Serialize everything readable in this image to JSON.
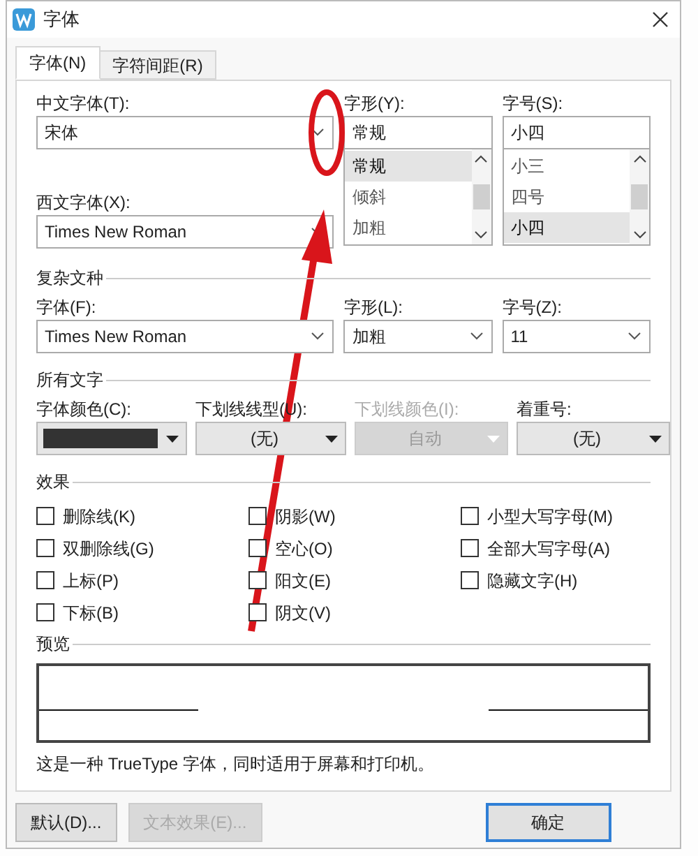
{
  "window": {
    "title": "字体"
  },
  "tabs": [
    {
      "label": "字体(N)",
      "selected": true
    },
    {
      "label": "字符间距(R)",
      "selected": false
    }
  ],
  "chinese_font": {
    "label": "中文字体(T):",
    "value": "宋体"
  },
  "western_font": {
    "label": "西文字体(X):",
    "value": "Times New Roman"
  },
  "style": {
    "label": "字形(Y):",
    "value": "常规",
    "options": [
      {
        "label": "常规",
        "selected": true
      },
      {
        "label": "倾斜",
        "selected": false
      },
      {
        "label": "加粗",
        "selected": false
      }
    ]
  },
  "size": {
    "label": "字号(S):",
    "value": "小四",
    "options": [
      {
        "label": "小三",
        "selected": false
      },
      {
        "label": "四号",
        "selected": false
      },
      {
        "label": "小四",
        "selected": true
      }
    ]
  },
  "complex_script": {
    "heading": "复杂文种",
    "font": {
      "label": "字体(F):",
      "value": "Times New Roman"
    },
    "style": {
      "label": "字形(L):",
      "value": "加粗"
    },
    "size": {
      "label": "字号(Z):",
      "value": "11"
    }
  },
  "all_text": {
    "heading": "所有文字",
    "fields": [
      {
        "kind": "color",
        "label": "字体颜色(C):",
        "color": "#333333",
        "disabled": false
      },
      {
        "kind": "dropdown",
        "label": "下划线线型(U):",
        "value": "(无)",
        "disabled": false
      },
      {
        "kind": "dropdown",
        "label": "下划线颜色(I):",
        "value": "自动",
        "disabled": true
      },
      {
        "kind": "dropdown",
        "label": "着重号:",
        "value": "(无)",
        "disabled": false
      }
    ]
  },
  "effects": {
    "heading": "效果",
    "columns": [
      {
        "items": [
          {
            "label": "删除线(K)",
            "checked": false
          },
          {
            "label": "双删除线(G)",
            "checked": false
          },
          {
            "label": "上标(P)",
            "checked": false
          },
          {
            "label": "下标(B)",
            "checked": false
          }
        ]
      },
      {
        "items": [
          {
            "label": "阴影(W)",
            "checked": false
          },
          {
            "label": "空心(O)",
            "checked": false
          },
          {
            "label": "阳文(E)",
            "checked": false
          },
          {
            "label": "阴文(V)",
            "checked": false
          }
        ]
      },
      {
        "items": [
          {
            "label": "小型大写字母(M)",
            "checked": false
          },
          {
            "label": "全部大写字母(A)",
            "checked": false
          },
          {
            "label": "隐藏文字(H)",
            "checked": false
          }
        ]
      }
    ]
  },
  "preview": {
    "heading": "预览",
    "description": "这是一种 TrueType 字体，同时适用于屏幕和打印机。"
  },
  "buttons": [
    {
      "label": "默认(D)...",
      "disabled": false,
      "default": false
    },
    {
      "label": "文本效果(E)...",
      "disabled": true,
      "default": false
    },
    {
      "label": "确定",
      "disabled": false,
      "default": true
    }
  ]
}
